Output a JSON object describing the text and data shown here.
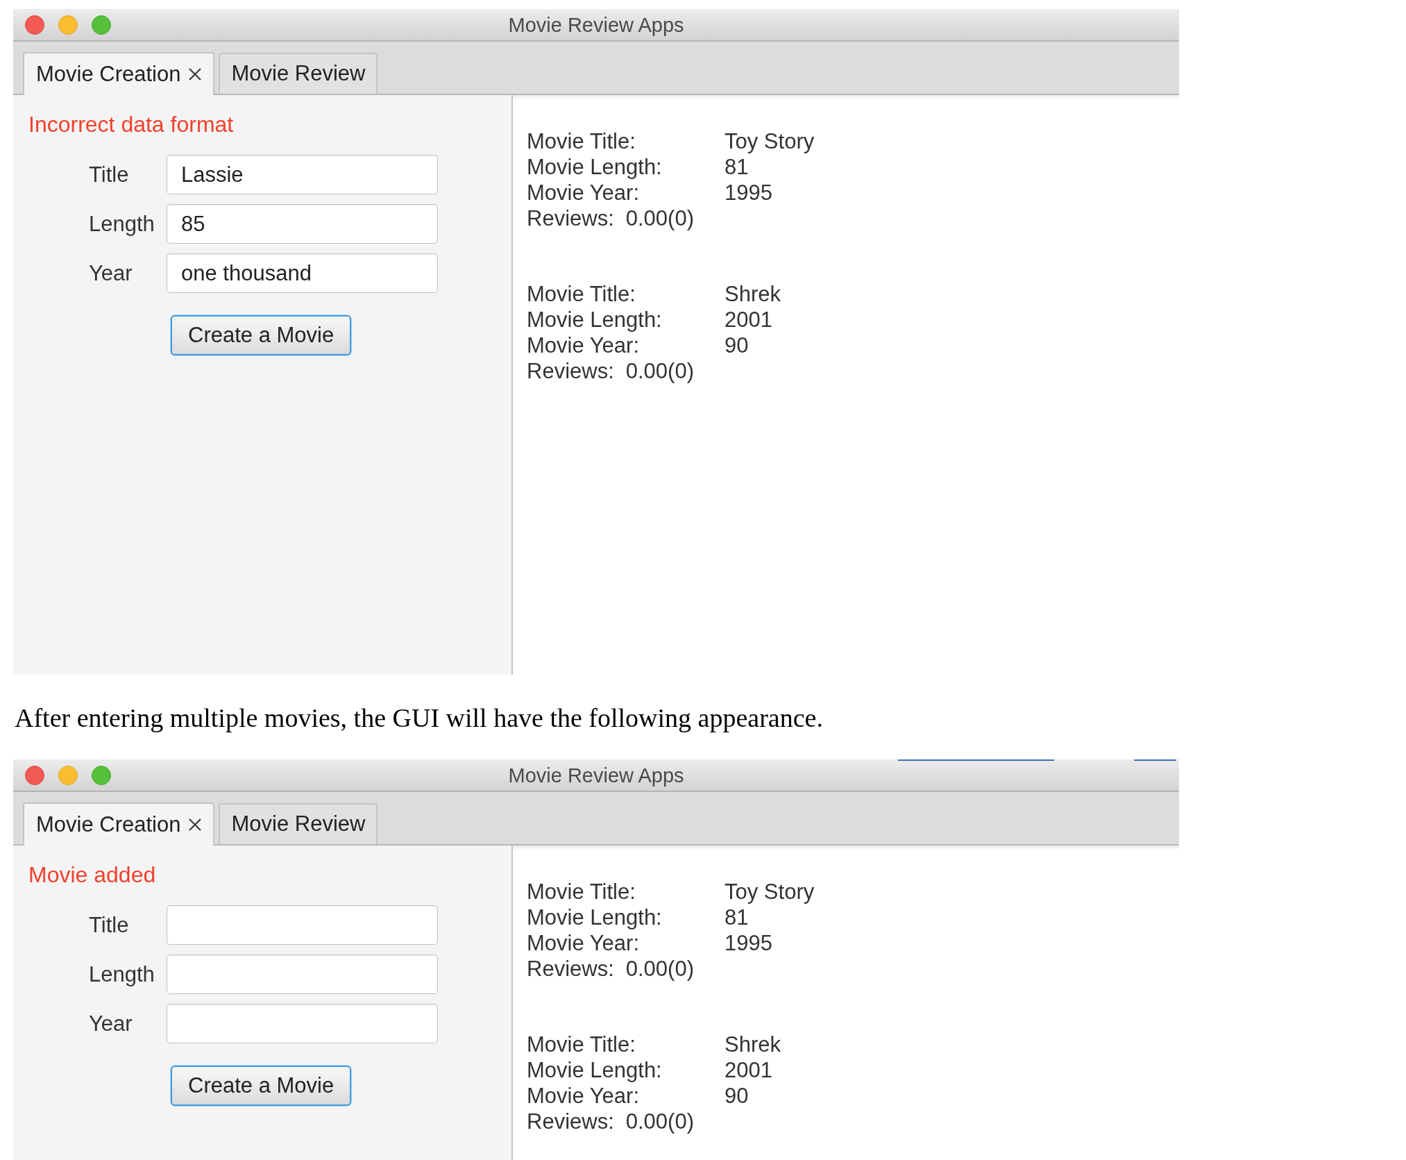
{
  "blocks": [
    {
      "kind": "window",
      "title": "Movie Review Apps",
      "tabs": [
        {
          "label": "Movie Creation",
          "closable": true,
          "selected": true
        },
        {
          "label": "Movie Review",
          "closable": false,
          "selected": false
        }
      ],
      "form": {
        "status_message": "Incorrect data format",
        "fields": [
          {
            "label": "Title",
            "value": "Lassie"
          },
          {
            "label": "Length",
            "value": "85"
          },
          {
            "label": "Year",
            "value": "one thousand"
          }
        ],
        "submit_button": {
          "label": "Create a Movie",
          "focused": true
        }
      },
      "movies": [
        {
          "details": [
            {
              "label": "Movie Title:",
              "value": "Toy Story"
            },
            {
              "label": "Movie Length:",
              "value": "81"
            },
            {
              "label": "Movie Year:",
              "value": "1995"
            }
          ],
          "reviews": {
            "label": "Reviews:",
            "value": "0.00(0)"
          }
        },
        {
          "details": [
            {
              "label": "Movie Title:",
              "value": "Shrek"
            },
            {
              "label": "Movie Length:",
              "value": "2001"
            },
            {
              "label": "Movie Year:",
              "value": "90"
            }
          ],
          "reviews": {
            "label": "Reviews:",
            "value": "0.00(0)"
          }
        }
      ]
    },
    {
      "kind": "paragraph",
      "text": "After entering multiple movies, the GUI will have the following appearance."
    },
    {
      "kind": "window",
      "title": "Movie Review Apps",
      "tabs": [
        {
          "label": "Movie Creation",
          "closable": true,
          "selected": true
        },
        {
          "label": "Movie Review",
          "closable": false,
          "selected": false
        }
      ],
      "form": {
        "status_message": "Movie added",
        "fields": [
          {
            "label": "Title"
          },
          {
            "label": "Length"
          },
          {
            "label": "Year"
          }
        ],
        "submit_button": {
          "label": "Create a Movie",
          "focused": true
        }
      },
      "movies": [
        {
          "details": [
            {
              "label": "Movie Title:",
              "value": "Toy Story"
            },
            {
              "label": "Movie Length:",
              "value": "81"
            },
            {
              "label": "Movie Year:",
              "value": "1995"
            }
          ],
          "reviews": {
            "label": "Reviews:",
            "value": "0.00(0)"
          }
        },
        {
          "details": [
            {
              "label": "Movie Title:",
              "value": "Shrek"
            },
            {
              "label": "Movie Length:",
              "value": "2001"
            },
            {
              "label": "Movie Year:",
              "value": "90"
            }
          ],
          "reviews": {
            "label": "Reviews:",
            "value": "0.00(0)"
          }
        }
      ]
    }
  ]
}
